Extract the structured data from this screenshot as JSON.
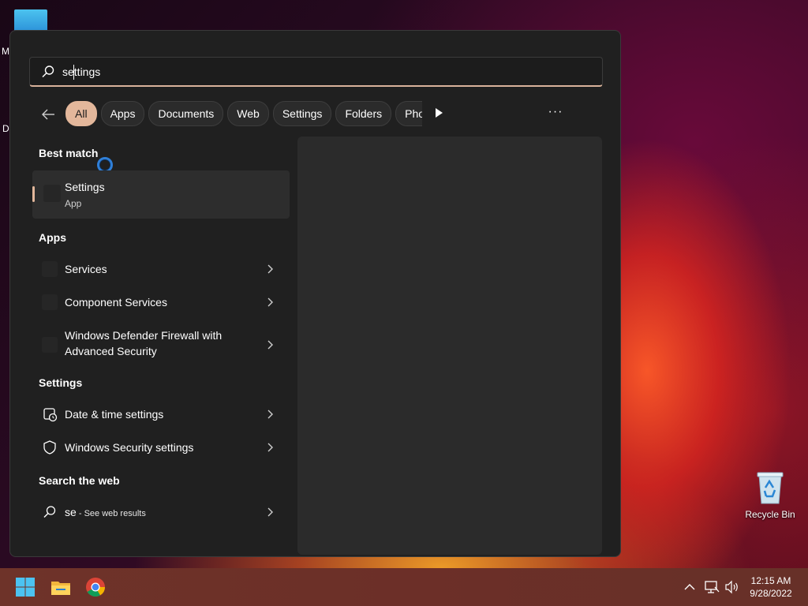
{
  "desktop": {
    "edge_letters": [
      "M",
      "D"
    ],
    "recycle_bin_label": "Recycle Bin"
  },
  "search": {
    "value": "settings"
  },
  "filters": [
    {
      "label": "All",
      "active": true
    },
    {
      "label": "Apps"
    },
    {
      "label": "Documents"
    },
    {
      "label": "Web"
    },
    {
      "label": "Settings"
    },
    {
      "label": "Folders"
    },
    {
      "label": "Photos"
    }
  ],
  "more_label": "···",
  "best_match": {
    "heading": "Best match",
    "title": "Settings",
    "subtitle": "App"
  },
  "apps": {
    "heading": "Apps",
    "items": [
      {
        "label": "Services"
      },
      {
        "label": "Component Services"
      },
      {
        "label_line1": "Windows Defender Firewall with",
        "label_line2": "Advanced Security"
      }
    ]
  },
  "settings_section": {
    "heading": "Settings",
    "items": [
      {
        "label": "Date & time settings",
        "icon": "clock-icon"
      },
      {
        "label": "Windows Security settings",
        "icon": "shield-icon"
      }
    ]
  },
  "web": {
    "heading": "Search the web",
    "query": "se",
    "suffix": " - See web results"
  },
  "taskbar": {
    "time": "12:15 AM",
    "date": "9/28/2022"
  }
}
